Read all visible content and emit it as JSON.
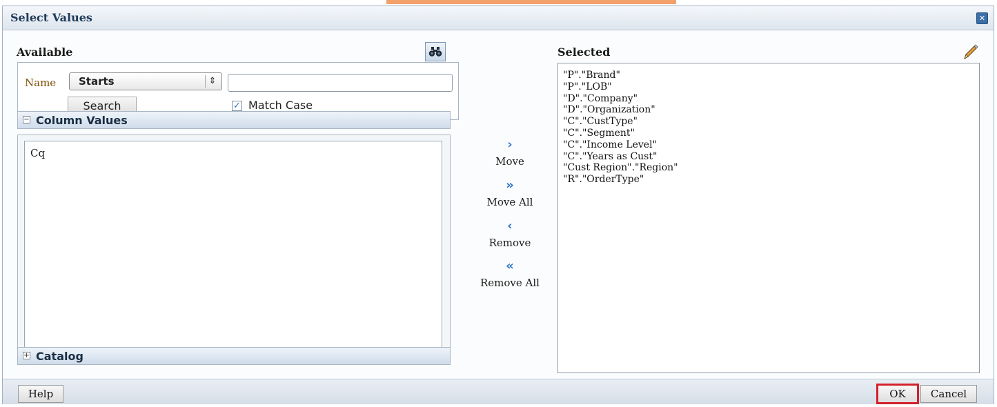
{
  "dialog": {
    "title": "Select Values"
  },
  "available": {
    "heading": "Available",
    "name_label": "Name",
    "operator_value": "Starts",
    "search_value": "",
    "search_button": "Search",
    "match_case_label": "Match Case",
    "match_case_checked": true,
    "column_values_header": "Column Values",
    "column_values": [
      "Cq"
    ],
    "catalog_header": "Catalog"
  },
  "shuttle": {
    "move": "Move",
    "move_all": "Move All",
    "remove": "Remove",
    "remove_all": "Remove All"
  },
  "selected": {
    "heading": "Selected",
    "items": [
      "\"P\".\"Brand\"",
      "\"P\".\"LOB\"",
      "\"D\".\"Company\"",
      "\"D\".\"Organization\"",
      "\"C\".\"CustType\"",
      "\"C\".\"Segment\"",
      "\"C\".\"Income Level\"",
      "\"C\".\"Years as Cust\"",
      "\"Cust Region\".\"Region\"",
      "\"R\".\"OrderType\""
    ]
  },
  "footer": {
    "help": "Help",
    "ok": "OK",
    "cancel": "Cancel"
  },
  "icons": {
    "search_values": "binoculars-icon",
    "edit": "pencil-icon",
    "close": "close-icon"
  },
  "colors": {
    "accent": "#2f76c9",
    "title": "#213a5a",
    "highlight": "#d2202b"
  }
}
